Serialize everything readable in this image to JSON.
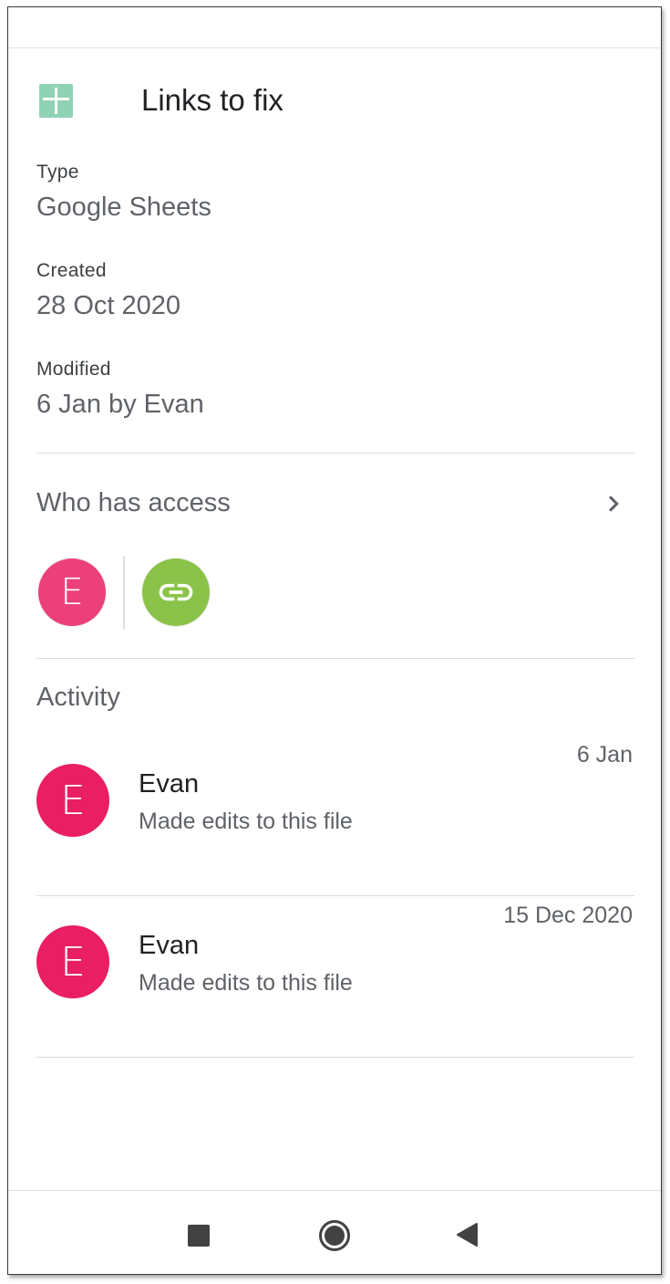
{
  "header": {
    "title": "Links to fix",
    "file_icon": "google-sheets-icon"
  },
  "details": {
    "type_label": "Type",
    "type_value": "Google Sheets",
    "created_label": "Created",
    "created_value": "28 Oct 2020",
    "modified_label": "Modified",
    "modified_value": "6 Jan by Evan"
  },
  "access": {
    "title": "Who has access",
    "chevron_icon": "chevron-right-icon",
    "user_initial": "E",
    "link_icon": "link-icon",
    "colors": {
      "user": "#ec407a",
      "link": "#8bc34a"
    }
  },
  "activity": {
    "title": "Activity",
    "items": [
      {
        "initial": "E",
        "name": "Evan",
        "action": "Made edits to this file",
        "date": "6 Jan"
      },
      {
        "initial": "E",
        "name": "Evan",
        "action": "Made edits to this file",
        "date": "15 Dec 2020"
      }
    ],
    "avatar_color": "#e91e63"
  },
  "navbar": {
    "recents_icon": "square-recents-icon",
    "home_icon": "circle-home-icon",
    "back_icon": "triangle-back-icon"
  }
}
